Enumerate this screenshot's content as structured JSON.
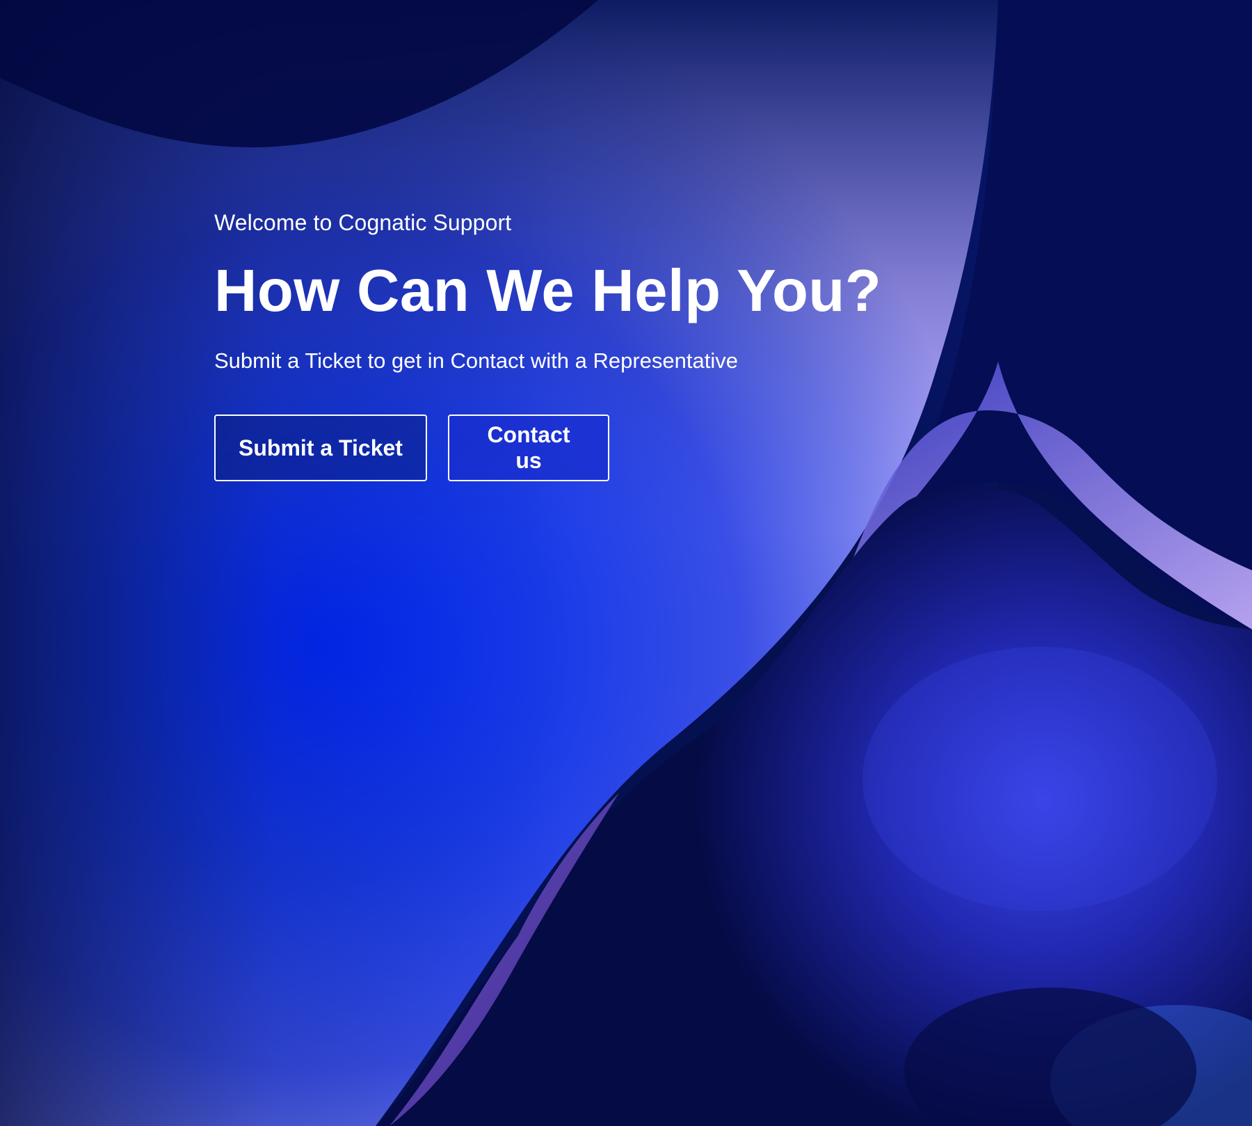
{
  "hero": {
    "eyebrow": "Welcome to Cognatic Support",
    "headline": "How Can We Help You?",
    "subline": "Submit a Ticket to get in Contact with a Representative"
  },
  "actions": {
    "submit_ticket": "Submit a Ticket",
    "contact_us": "Contact us"
  },
  "colors": {
    "background_dark": "#04104f",
    "background_blue": "#1535f0",
    "highlight_lavender": "#c8b2ff",
    "text": "#ffffff"
  }
}
